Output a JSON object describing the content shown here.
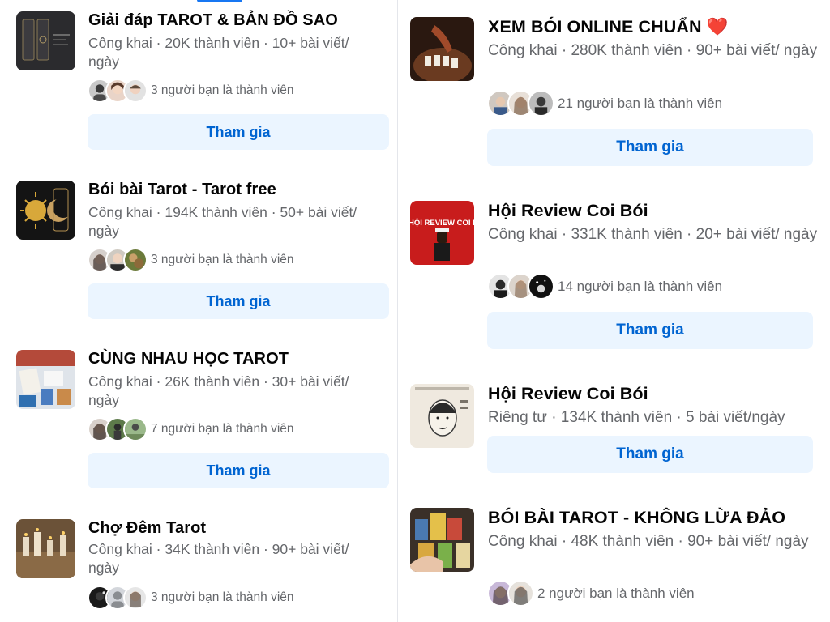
{
  "left_groups": [
    {
      "name": "Giải đáp TAROT & BẢN ĐỒ SAO",
      "meta": "Công khai · 20K thành viên · 10+ bài viết/ ngày",
      "friends": "3 người bạn là thành viên",
      "join_label": "Tham gia",
      "thumb_icon": "tarot-cards-dark-image"
    },
    {
      "name": "Bói bài Tarot - Tarot free",
      "meta": "Công khai · 194K thành viên · 50+ bài viết/ ngày",
      "friends": "3 người bạn là thành viên",
      "join_label": "Tham gia",
      "thumb_icon": "sun-moon-image"
    },
    {
      "name": "CÙNG NHAU HỌC TAROT",
      "meta": "Công khai · 26K thành viên · 30+ bài viết/ ngày",
      "friends": "7 người bạn là thành viên",
      "join_label": "Tham gia",
      "thumb_icon": "tarot-table-image"
    },
    {
      "name": "Chợ Đêm Tarot",
      "meta": "Công khai · 34K thành viên · 90+ bài viết/ ngày",
      "friends": "3 người bạn là thành viên",
      "join_label": "Tham gia",
      "thumb_icon": "candles-image"
    }
  ],
  "right_groups": [
    {
      "name": "XEM BÓI ONLINE CHUẨN",
      "emoji": "❤️",
      "meta": "Công khai · 280K thành viên · 90+ bài viết/ ngày",
      "friends": "21 người bạn là thành viên",
      "join_label": "Tham gia",
      "thumb_icon": "card-reading-image"
    },
    {
      "name": "Hội Review Coi Bói",
      "meta": "Công khai · 331K thành viên · 20+ bài viết/ ngày",
      "friends": "14 người bạn là thành viên",
      "join_label": "Tham gia",
      "thumb_text": "HỘI REVIEW COI BÓ",
      "thumb_icon": "red-poster-image"
    },
    {
      "name": "Hội Review Coi Bói",
      "meta": "Riêng tư · 134K thành viên · 5 bài viết/ngày",
      "join_label": "Tham gia",
      "thumb_icon": "face-sketch-image"
    },
    {
      "name": "BÓI BÀI TAROT - KHÔNG LỪA ĐẢO",
      "meta": "Công khai · 48K thành viên · 90+ bài viết/ ngày",
      "friends": "2 người bạn là thành viên",
      "thumb_icon": "tarot-hand-image"
    }
  ],
  "colors": {
    "join_bg": "#ebf5ff",
    "join_text": "#0064d1",
    "meta_text": "#65676b"
  }
}
